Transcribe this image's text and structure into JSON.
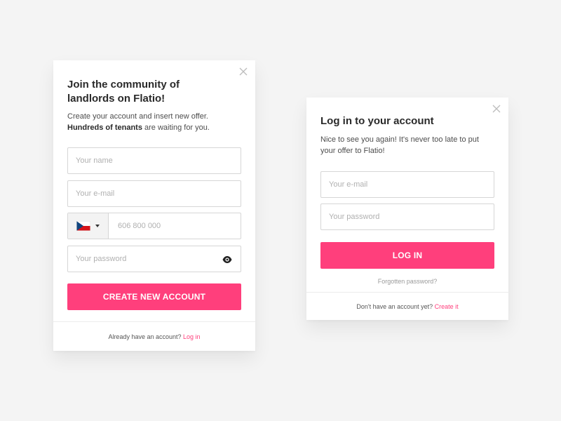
{
  "colors": {
    "page_background": "#f4f4f4",
    "card_background": "#ffffff",
    "accent": "#ff3f7c",
    "input_border": "#d6d6d6"
  },
  "signup": {
    "title": "Join the community of landlords on Flatio!",
    "desc_line1": "Create your account and insert new offer.",
    "desc_bold": "Hundreds of tenants",
    "desc_rest": " are waiting for you.",
    "name_placeholder": "Your name",
    "email_placeholder": "Your e-mail",
    "country_flag": "czech-republic-flag",
    "phone_placeholder": "606 800 000",
    "password_placeholder": "Your password",
    "password_toggle_icon": "eye-icon",
    "close_icon": "close-icon",
    "submit_label": "CREATE NEW ACCOUNT",
    "footer_text": "Already have an account? ",
    "footer_link": "Log in"
  },
  "login": {
    "title": "Log in to your account",
    "desc": "Nice to see you again! It's never too late to put your offer to Flatio!",
    "email_placeholder": "Your e-mail",
    "password_placeholder": "Your password",
    "close_icon": "close-icon",
    "submit_label": "LOG IN",
    "forgot_link": "Forgotten password?",
    "footer_text": "Don't have an account yet? ",
    "footer_link": "Create it"
  }
}
